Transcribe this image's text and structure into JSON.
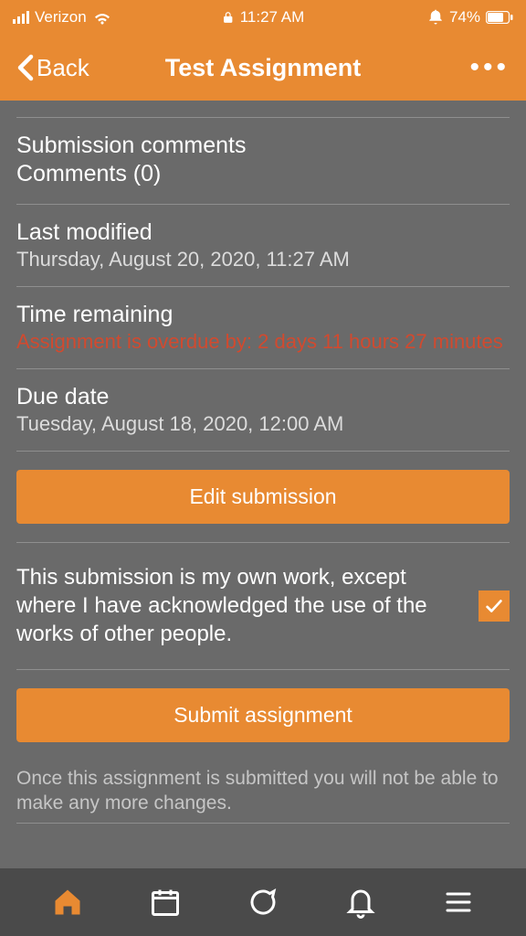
{
  "status": {
    "carrier": "Verizon",
    "time": "11:27 AM",
    "battery": "74%"
  },
  "nav": {
    "back_label": "Back",
    "title": "Test Assignment"
  },
  "sections": {
    "comments": {
      "title": "Submission comments",
      "value": "Comments (0)"
    },
    "last_modified": {
      "title": "Last modified",
      "value": "Thursday, August 20, 2020, 11:27 AM"
    },
    "time_remaining": {
      "title": "Time remaining",
      "value": "Assignment is overdue by: 2 days 11 hours 27 minutes"
    },
    "due_date": {
      "title": "Due date",
      "value": "Tuesday, August 18, 2020, 12:00 AM"
    }
  },
  "buttons": {
    "edit": "Edit submission",
    "submit": "Submit assignment"
  },
  "acknowledgement": {
    "text": "This submission is my own work, except where I have acknowledged the use of the works of other people.",
    "checked": true
  },
  "hint": "Once this assignment is submitted you will not be able to make any more changes.",
  "colors": {
    "accent": "#e88a32",
    "bg": "#6a6a6a",
    "alert": "#d14a2f"
  }
}
